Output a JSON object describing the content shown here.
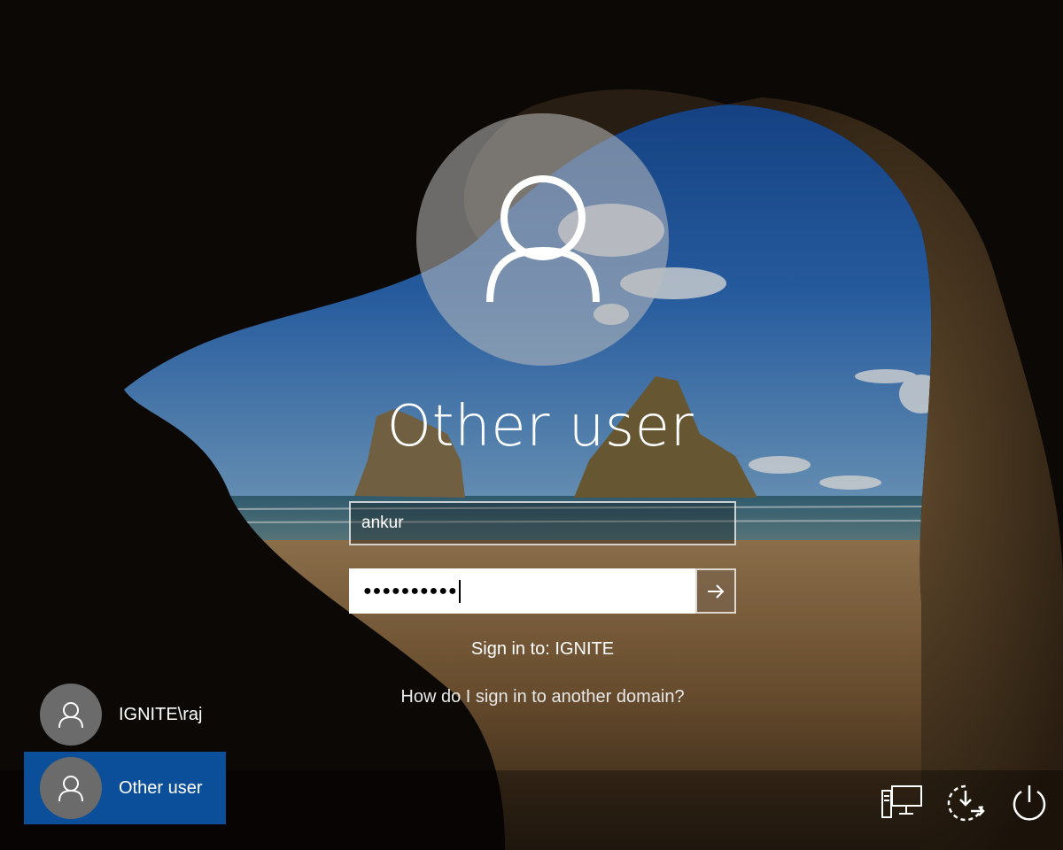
{
  "login": {
    "title": "Other user",
    "username_value": "ankur",
    "password_mask": "●●●●●●●●●●",
    "submit_icon": "arrow-right-icon",
    "sign_in_to": "Sign in to: IGNITE",
    "domain_help_link": "How do I sign in to another domain?"
  },
  "users": [
    {
      "label": "IGNITE\\raj",
      "selected": false
    },
    {
      "label": "Other user",
      "selected": true
    }
  ],
  "corner_icons": [
    "network-icon",
    "accessibility-icon",
    "power-icon"
  ],
  "colors": {
    "selected_tile": "#0b4f9a",
    "avatar_circle": "#6b6b6b"
  }
}
